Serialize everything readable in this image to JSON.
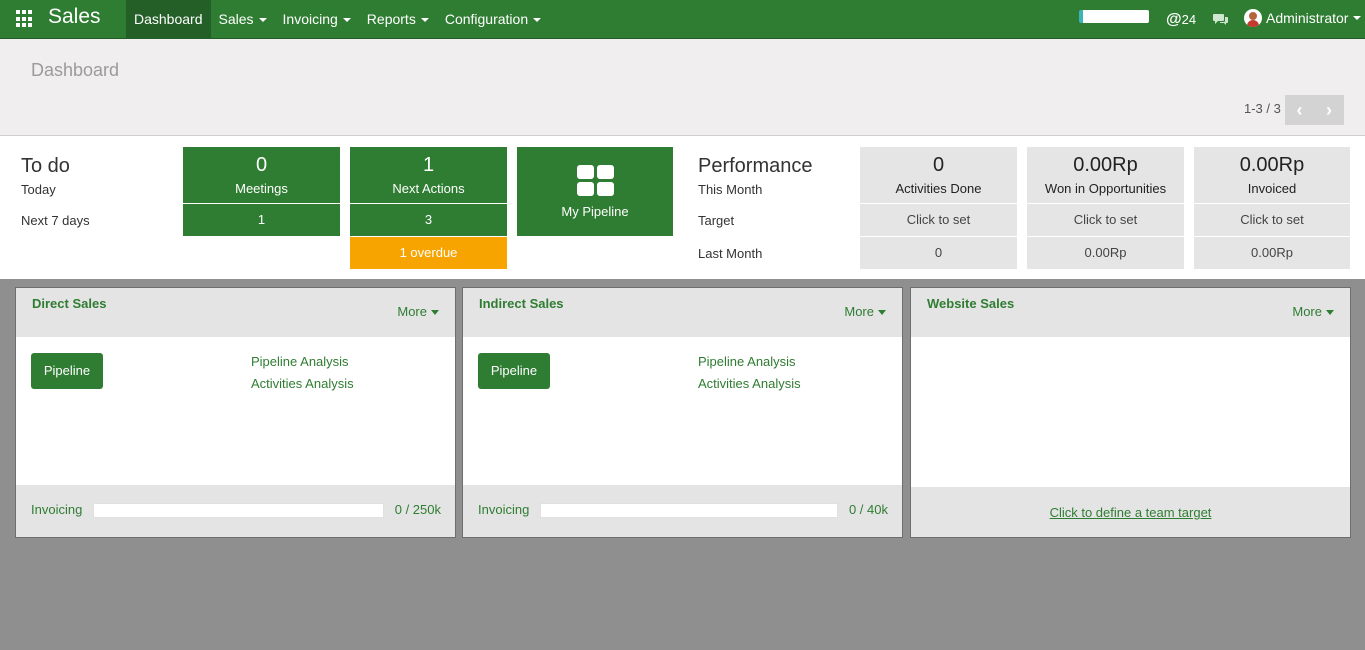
{
  "navbar": {
    "app_name": "Sales",
    "menu": [
      {
        "label": "Dashboard",
        "active": true,
        "dropdown": false
      },
      {
        "label": "Sales",
        "active": false,
        "dropdown": true
      },
      {
        "label": "Invoicing",
        "active": false,
        "dropdown": true
      },
      {
        "label": "Reports",
        "active": false,
        "dropdown": true
      },
      {
        "label": "Configuration",
        "active": false,
        "dropdown": true
      }
    ],
    "mentions_count": "24",
    "user_name": "Administrator"
  },
  "control_panel": {
    "title": "Dashboard",
    "pager": "1-3 / 3"
  },
  "todo": {
    "title": "To do",
    "today_label": "Today",
    "next7_label": "Next 7 days",
    "meetings_value": "0",
    "meetings_label": "Meetings",
    "meetings_next7": "1",
    "actions_value": "1",
    "actions_label": "Next Actions",
    "actions_next7": "3",
    "overdue": "1 overdue",
    "pipeline_label": "My Pipeline"
  },
  "performance": {
    "title": "Performance",
    "this_month_label": "This Month",
    "target_label": "Target",
    "last_month_label": "Last Month",
    "tiles": [
      {
        "value": "0",
        "label": "Activities Done",
        "target": "Click to set",
        "last_month": "0"
      },
      {
        "value": "0.00Rp",
        "label": "Won in Opportunities",
        "target": "Click to set",
        "last_month": "0.00Rp"
      },
      {
        "value": "0.00Rp",
        "label": "Invoiced",
        "target": "Click to set",
        "last_month": "0.00Rp"
      }
    ]
  },
  "teams": [
    {
      "name": "Direct Sales",
      "more": "More",
      "pipeline_button": "Pipeline",
      "links": [
        "Pipeline Analysis",
        "Activities Analysis"
      ],
      "footer_label": "Invoicing",
      "footer_value": "0 / 250k",
      "invoicing_progress": 0
    },
    {
      "name": "Indirect Sales",
      "more": "More",
      "pipeline_button": "Pipeline",
      "links": [
        "Pipeline Analysis",
        "Activities Analysis"
      ],
      "footer_label": "Invoicing",
      "footer_value": "0 / 40k",
      "invoicing_progress": 0
    },
    {
      "name": "Website Sales",
      "more": "More",
      "team_target_link": "Click to define a team target"
    }
  ],
  "colors": {
    "brand_green": "#2f7d32",
    "overdue_orange": "#f8a400",
    "tile_grey": "#e5e5e5"
  }
}
